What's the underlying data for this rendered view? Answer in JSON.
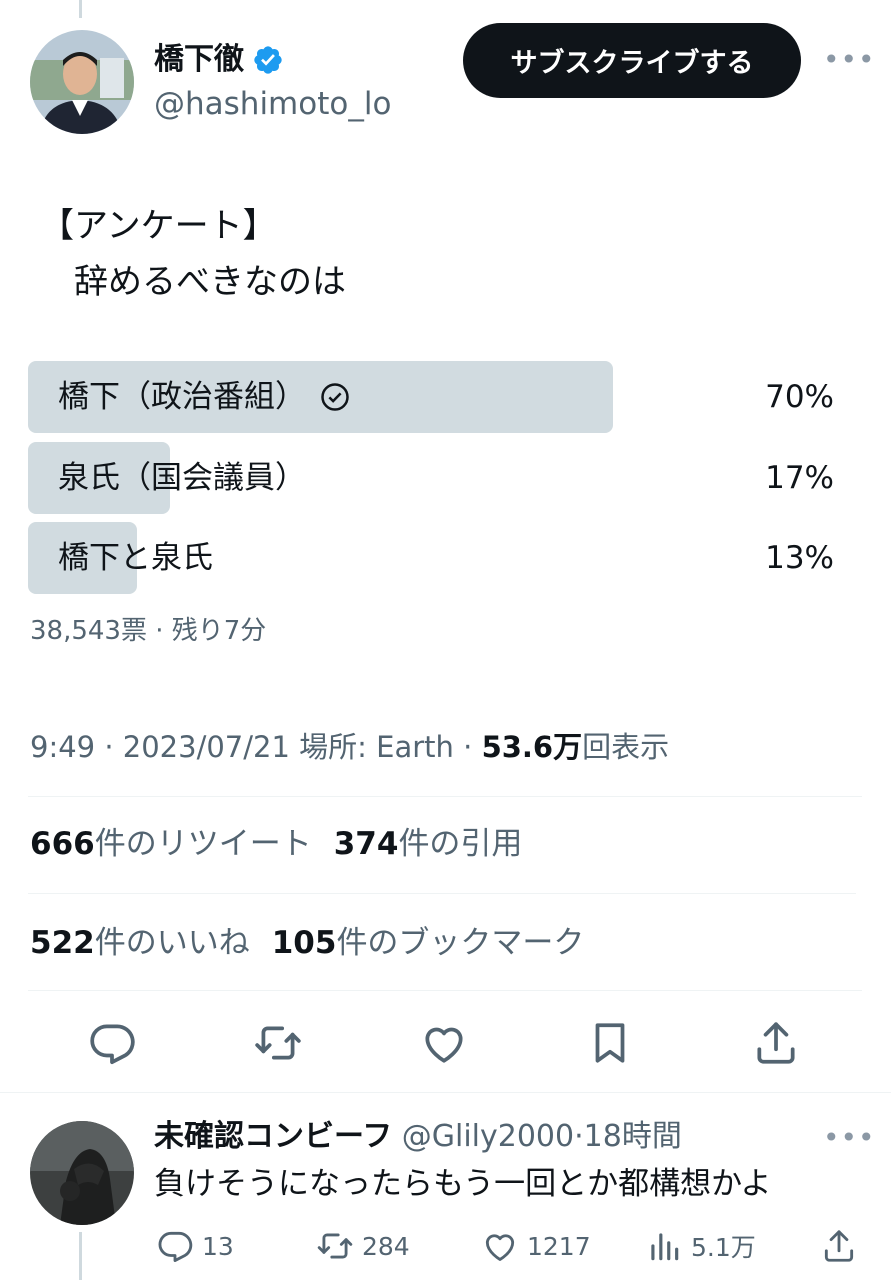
{
  "tweet": {
    "author": {
      "name": "橋下徹",
      "handle": "@hashimoto_lo",
      "verified": true
    },
    "subscribe_label": "サブスクライブする",
    "text": "【アンケート】\n　辞めるべきなのは",
    "poll": {
      "options": [
        {
          "label": "橋下（政治番組）",
          "percent": "70%",
          "value": 0.7,
          "winner": true
        },
        {
          "label": "泉氏（国会議員）",
          "percent": "17%",
          "value": 0.17,
          "winner": false
        },
        {
          "label": "橋下と泉氏",
          "percent": "13%",
          "value": 0.13,
          "winner": false
        }
      ],
      "meta": "38,543票 · 残り7分"
    },
    "timestamp": "9:49 · 2023/07/21 場所: Earth · ",
    "views_count": "53.6万",
    "views_label": "回表示",
    "stats": {
      "retweets_count": "666",
      "retweets_label": "件のリツイート",
      "quotes_count": "374",
      "quotes_label": "件の引用",
      "likes_count": "522",
      "likes_label": "件のいいね",
      "bookmarks_count": "105",
      "bookmarks_label": "件のブックマーク"
    },
    "actions": [
      "reply-icon",
      "retweet-icon",
      "like-icon",
      "bookmark-icon",
      "share-icon"
    ]
  },
  "reply": {
    "name": "未確認コンビーフ",
    "handle": "@Glily2000",
    "time": "·18時間",
    "text": "負けそうになったらもう一回とか都構想かよ",
    "counts": {
      "replies": "13",
      "retweets": "284",
      "likes": "1217",
      "views": "5.1万"
    }
  },
  "colors": {
    "accent": "#1d9bf0",
    "text": "#0f1419",
    "secondary": "#536471",
    "poll_bar": "#cfd9de",
    "button": "#0f1419"
  }
}
